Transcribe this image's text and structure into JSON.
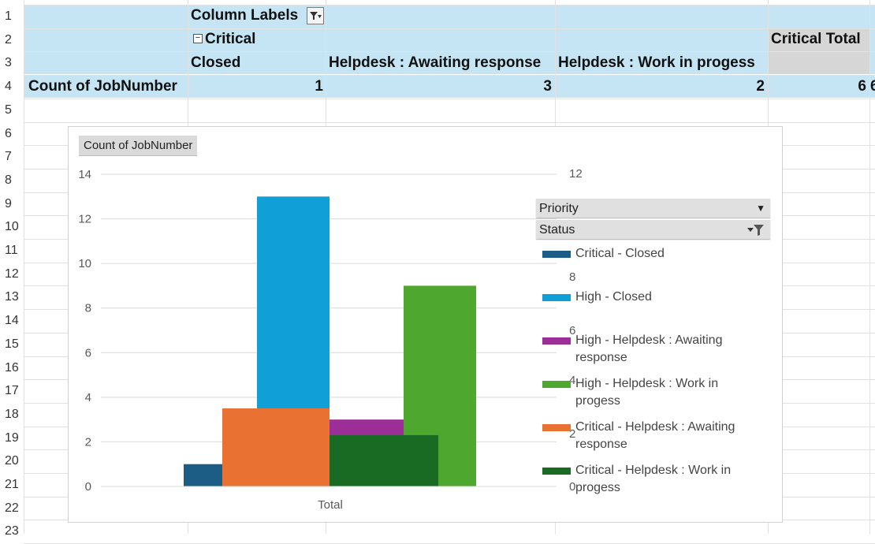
{
  "rows": [
    "1",
    "2",
    "3",
    "4",
    "5",
    "6",
    "7",
    "8",
    "9",
    "10",
    "11",
    "12",
    "13",
    "14",
    "15",
    "16",
    "17",
    "18",
    "19",
    "20",
    "21",
    "22",
    "23"
  ],
  "pivot": {
    "column_labels": "Column Labels",
    "group_label": "Critical",
    "collapse_symbol": "−",
    "headers": [
      "Closed",
      "Helpdesk : Awaiting response",
      "Helpdesk : Work in progess"
    ],
    "total_header": "Critical Total",
    "row_label": "Count of JobNumber",
    "values": [
      "1",
      "3",
      "2"
    ],
    "total_value": "6",
    "next_value": "6"
  },
  "chart": {
    "field_button": "Count of JobNumber",
    "legend_fields": [
      "Priority",
      "Status"
    ],
    "secondary_ticks": [
      "12",
      "8",
      "6",
      "4",
      "2",
      "0"
    ],
    "legend": [
      {
        "label": "Critical - Closed",
        "color": "#1b5d84"
      },
      {
        "label": "High - Closed",
        "color": "#109fd6"
      },
      {
        "label": "High - Helpdesk : Awaiting response",
        "color": "#9b2f97"
      },
      {
        "label": "High - Helpdesk : Work in progess",
        "color": "#4ea72e"
      },
      {
        "label": "Critical - Helpdesk : Awaiting response",
        "color": "#e97132"
      },
      {
        "label": "Critical - Helpdesk : Work in progess",
        "color": "#196b24"
      }
    ]
  },
  "chart_data": {
    "type": "bar",
    "categories": [
      "Total"
    ],
    "ylim": [
      0,
      14
    ],
    "yticks": [
      "0",
      "2",
      "4",
      "6",
      "8",
      "10",
      "12",
      "14"
    ],
    "series": [
      {
        "name": "Critical - Closed",
        "values": [
          1
        ]
      },
      {
        "name": "High - Closed",
        "values": [
          13
        ]
      },
      {
        "name": "Critical - Helpdesk : Awaiting response",
        "values": [
          3.5
        ]
      },
      {
        "name": "High - Helpdesk : Awaiting response",
        "values": [
          3
        ]
      },
      {
        "name": "Critical - Helpdesk : Work in progess",
        "values": [
          2.3
        ]
      },
      {
        "name": "High - Helpdesk : Work in progess",
        "values": [
          9
        ]
      }
    ],
    "legend_position": "right"
  }
}
